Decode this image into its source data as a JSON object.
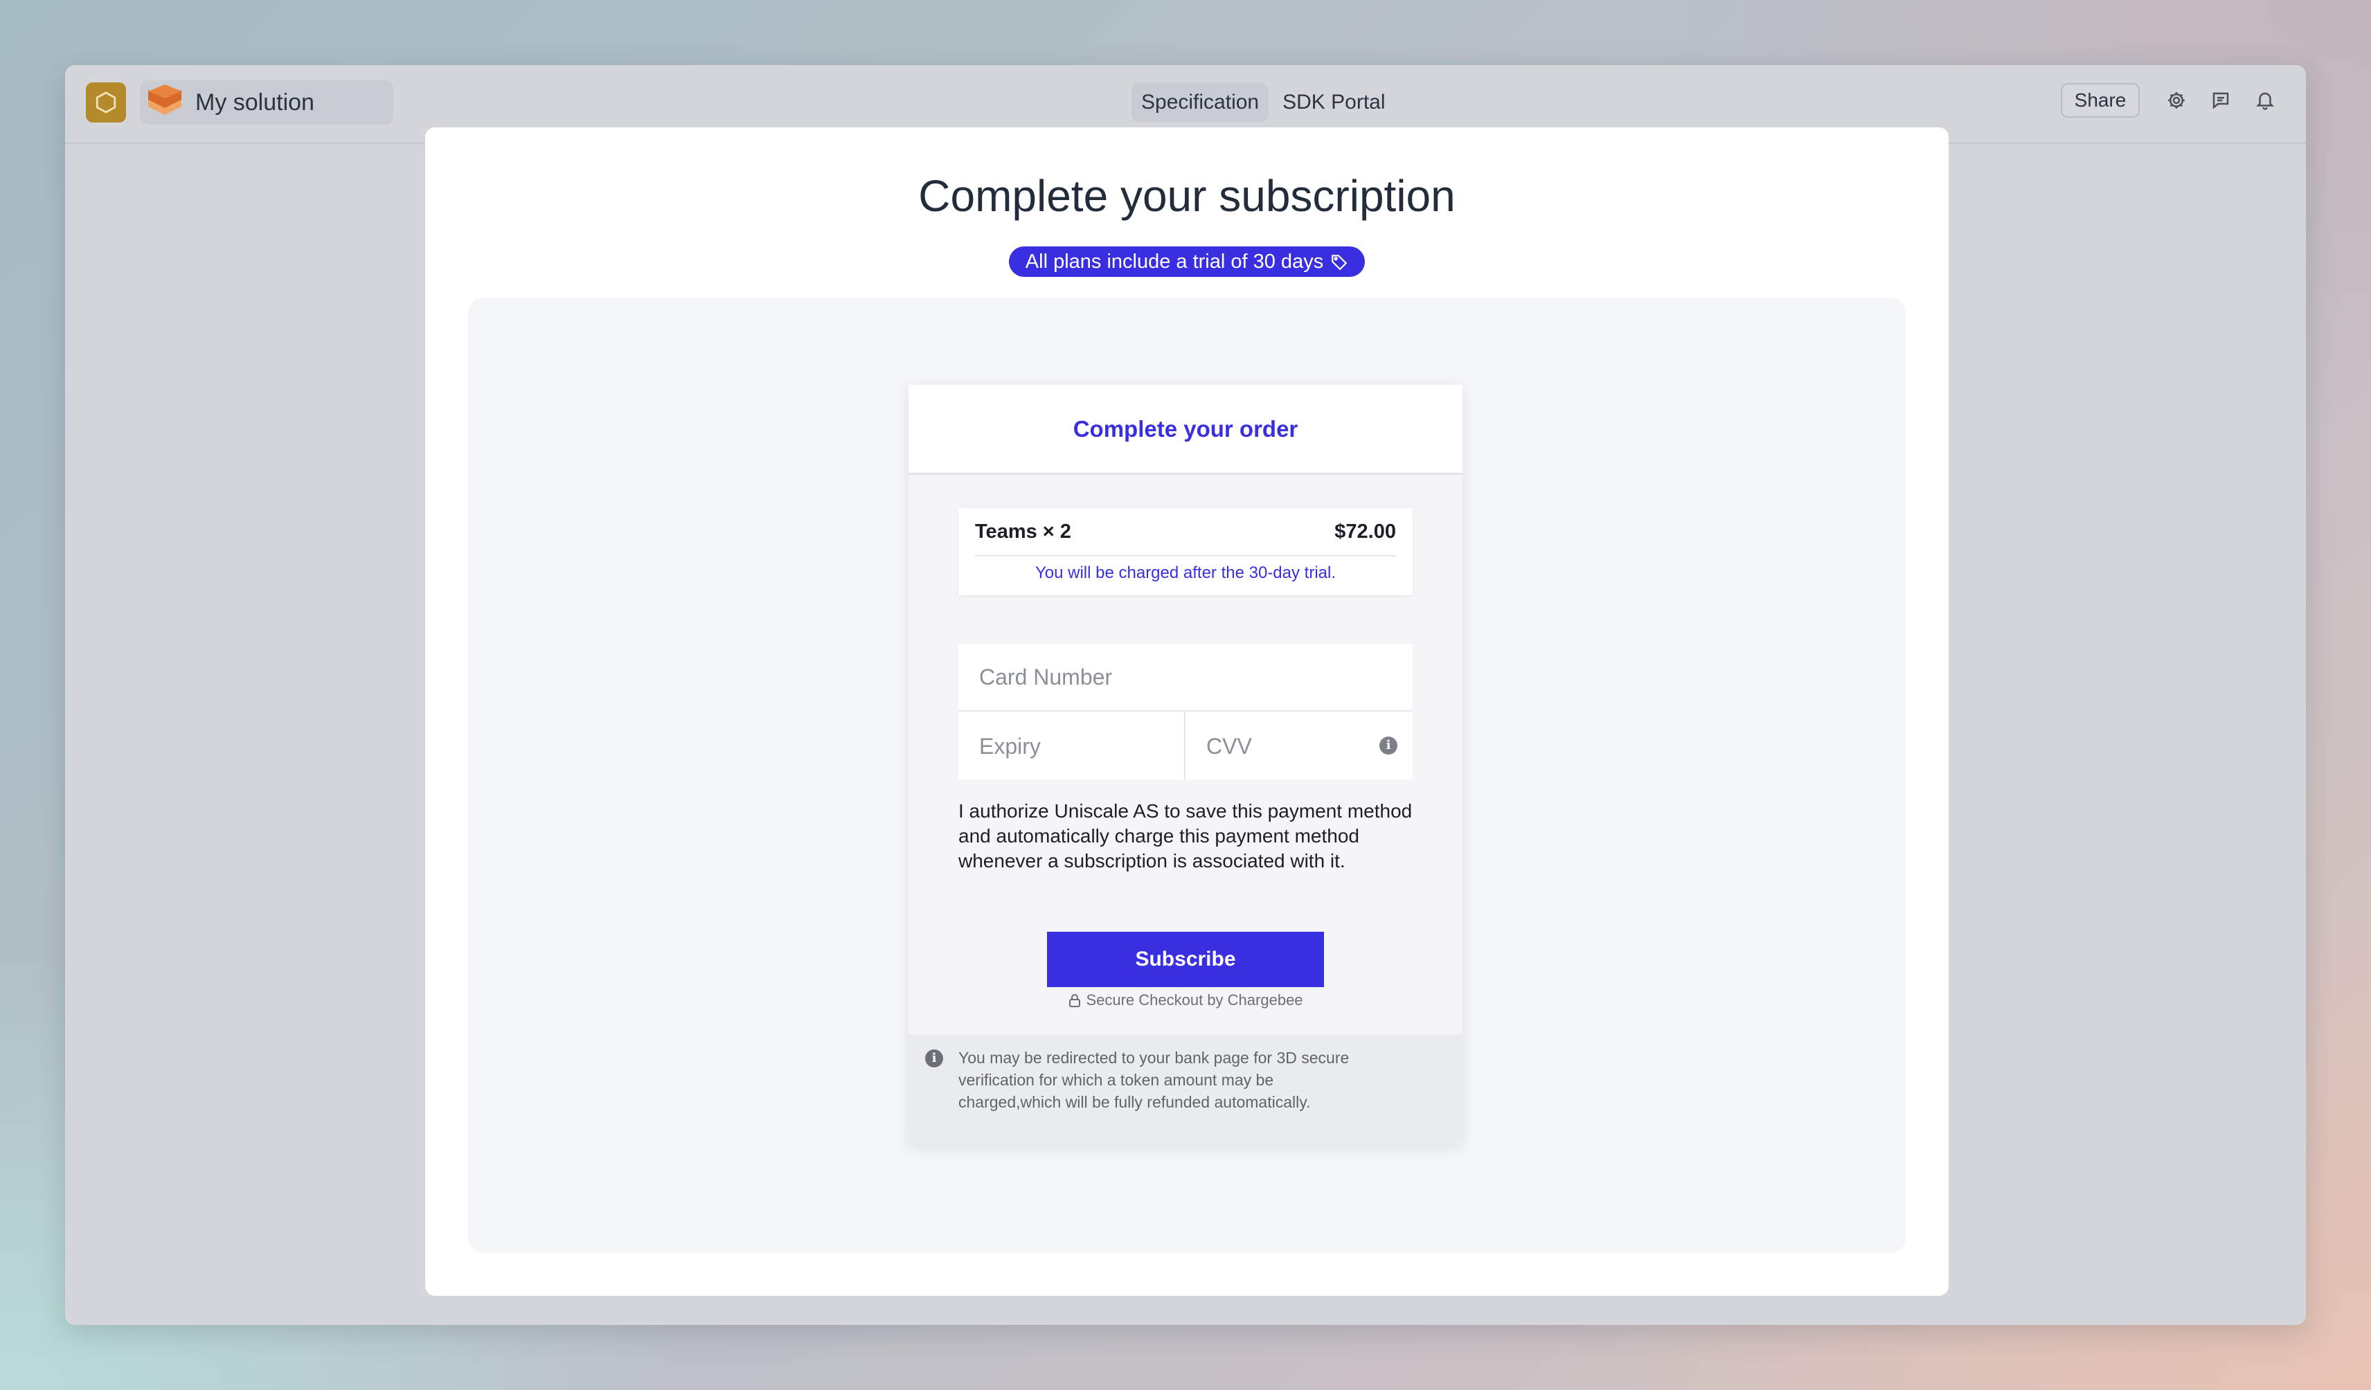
{
  "header": {
    "solution_name": "My solution",
    "tabs": [
      {
        "label": "Specification",
        "active": true
      },
      {
        "label": "SDK Portal",
        "active": false
      }
    ],
    "share_label": "Share",
    "icons": [
      "settings-icon",
      "comment-icon",
      "bell-icon"
    ]
  },
  "modal": {
    "title": "Complete your subscription",
    "trial_badge": "All plans include a trial of 30 days",
    "order": {
      "title": "Complete your order",
      "item_label": "Teams × 2",
      "item_price": "$72.00",
      "charge_note": "You will be charged after the 30-day trial.",
      "card_number_placeholder": "Card Number",
      "expiry_placeholder": "Expiry",
      "cvv_placeholder": "CVV",
      "authorize_text": "I authorize Uniscale AS to save this payment method and automatically charge this payment method whenever a subscription is associated with it.",
      "subscribe_label": "Subscribe",
      "secure_text": "Secure Checkout by Chargebee",
      "notice_text": "You may be redirected to your bank page for 3D secure verification for which a token amount may be charged,which will be fully refunded automatically."
    }
  },
  "colors": {
    "accent": "#3a2fe0",
    "app_logo": "#b58a2a",
    "window_bg": "#d4d6db"
  }
}
